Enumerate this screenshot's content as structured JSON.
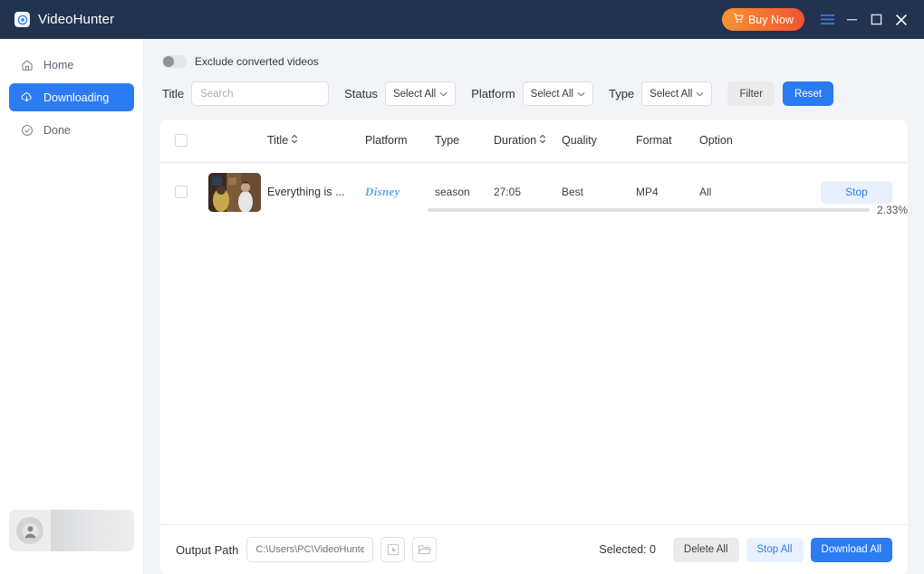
{
  "titlebar": {
    "app_name": "VideoHunter",
    "logo_icon": "target-logo-icon",
    "buy_now": "Buy Now",
    "cart_icon": "cart-icon",
    "menu_icon": "hamburger-menu-icon",
    "minimize_icon": "minimize-icon",
    "maximize_icon": "maximize-icon",
    "close_icon": "close-icon",
    "bg_color": "#22334f",
    "buy_now_gradient": [
      "#f79332",
      "#f2542f"
    ]
  },
  "sidebar": {
    "items": [
      {
        "label": "Home",
        "icon": "home-icon",
        "active": false
      },
      {
        "label": "Downloading",
        "icon": "download-cloud-icon",
        "active": true
      },
      {
        "label": "Done",
        "icon": "check-circle-icon",
        "active": false
      }
    ],
    "active_color": "#2b7bf3",
    "profile": {
      "avatar_icon": "user-avatar-icon"
    }
  },
  "filters": {
    "exclude_toggle": {
      "label": "Exclude converted videos",
      "on": false
    },
    "title_label": "Title",
    "search_placeholder": "Search",
    "search_value": "",
    "status_label": "Status",
    "status_value": "Select All",
    "platform_label": "Platform",
    "platform_value": "Select All",
    "type_label": "Type",
    "type_value": "Select All",
    "filter_button": "Filter",
    "reset_button": "Reset",
    "chevron_icon": "chevron-down-icon"
  },
  "table": {
    "headers": {
      "title": "Title",
      "platform": "Platform",
      "type": "Type",
      "duration": "Duration",
      "quality": "Quality",
      "format": "Format",
      "option": "Option"
    },
    "sort_icon": "sort-updown-icon",
    "rows": [
      {
        "selected": false,
        "thumbnail": "video-thumbnail",
        "title": "Everything is ...",
        "platform": "Disney",
        "platform_logo": "disney-plus-logo",
        "type": "season",
        "duration": "27:05",
        "quality": "Best",
        "format": "MP4",
        "option": "All",
        "action": "Stop",
        "progress_percent": "2.33%",
        "progress_value": 2.33
      }
    ]
  },
  "bottom": {
    "output_path_label": "Output Path",
    "output_path_value": "C:\\Users\\PC\\VideoHunter",
    "select_icon": "cursor-select-icon",
    "folder_icon": "folder-open-icon",
    "selected_label": "Selected: 0",
    "delete_all": "Delete All",
    "stop_all": "Stop All",
    "download_all": "Download All"
  }
}
